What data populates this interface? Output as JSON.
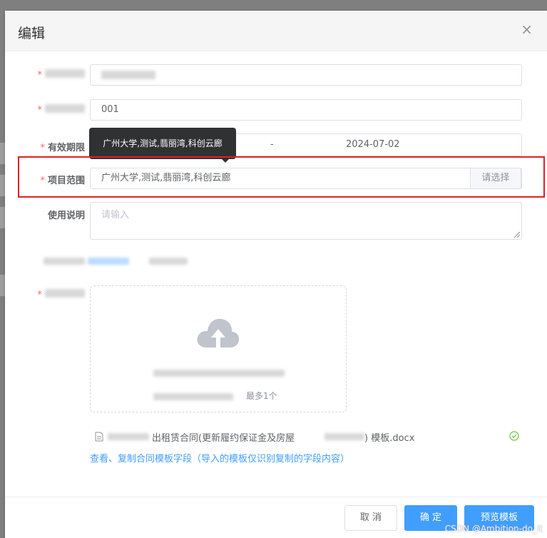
{
  "dialog": {
    "title": "编辑",
    "close_icon": "×"
  },
  "form": {
    "contract_name": {
      "value": ""
    },
    "contract_code": {
      "value": "001"
    },
    "valid_period": {
      "label": "有效期限",
      "separator": "-",
      "end_date": "2024-07-02"
    },
    "project_scope": {
      "label": "项目范围",
      "value": "广州大学,测试,翡丽湾,科创云廊",
      "button_label": "请选择",
      "tooltip": "广州大学,测试,翡丽湾,科创云廊"
    },
    "usage_notes": {
      "label": "使用说明",
      "placeholder": "请输入"
    },
    "upload": {
      "hint_suffix": "最多1个"
    },
    "uploaded_file": {
      "name_visible_part": "出租赁合同(更新履约保证金及房屋",
      "name_suffix": ") 模板.docx"
    },
    "template_link": "查看、复制合同模板字段（导入的模板仅识别复制的字段内容）"
  },
  "footer": {
    "cancel_label": "取 消",
    "confirm_label": "确 定",
    "preview_label": "预览模板"
  },
  "watermark": "CSDN @Ambition-do_it",
  "colors": {
    "primary": "#409eff",
    "required": "#f56c6c",
    "highlight": "#e02020",
    "success": "#67c23a"
  }
}
